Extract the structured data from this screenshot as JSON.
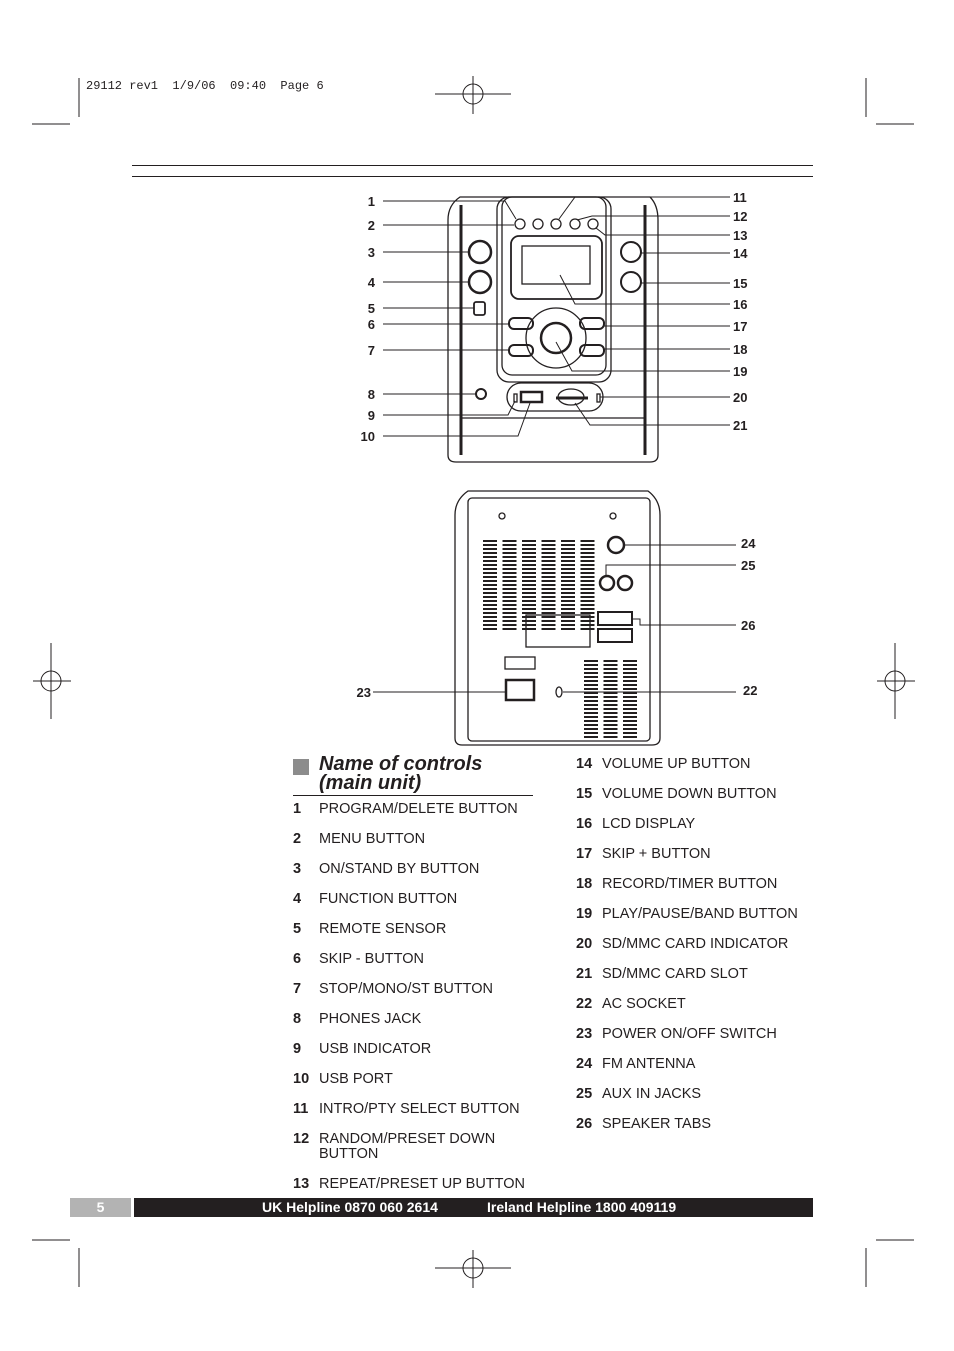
{
  "slug": "29112 rev1  1/9/06  09:40  Page 6",
  "heading": {
    "line1": "Name of controls",
    "line2": "(main unit)"
  },
  "front_callouts_left": [
    "1",
    "2",
    "3",
    "4",
    "5",
    "6",
    "7",
    "8",
    "9",
    "10"
  ],
  "front_callouts_right": [
    "11",
    "12",
    "13",
    "14",
    "15",
    "16",
    "17",
    "18",
    "19",
    "20",
    "21"
  ],
  "back_callouts": [
    "24",
    "25",
    "26",
    "22",
    "23"
  ],
  "controls_left": [
    {
      "n": "1",
      "label": "PROGRAM/DELETE BUTTON"
    },
    {
      "n": "2",
      "label": "MENU BUTTON"
    },
    {
      "n": "3",
      "label": "ON/STAND BY BUTTON"
    },
    {
      "n": "4",
      "label": "FUNCTION BUTTON"
    },
    {
      "n": "5",
      "label": "REMOTE SENSOR"
    },
    {
      "n": "6",
      "label": "SKIP - BUTTON"
    },
    {
      "n": "7",
      "label": "STOP/MONO/ST BUTTON"
    },
    {
      "n": "8",
      "label": "PHONES JACK"
    },
    {
      "n": "9",
      "label": "USB INDICATOR"
    },
    {
      "n": "10",
      "label": "USB PORT"
    },
    {
      "n": "11",
      "label": "INTRO/PTY SELECT BUTTON"
    },
    {
      "n": "12",
      "label": "RANDOM/PRESET DOWN BUTTON"
    },
    {
      "n": "13",
      "label": "REPEAT/PRESET UP BUTTON"
    }
  ],
  "controls_right": [
    {
      "n": "14",
      "label": "VOLUME UP BUTTON"
    },
    {
      "n": "15",
      "label": "VOLUME DOWN BUTTON"
    },
    {
      "n": "16",
      "label": "LCD DISPLAY"
    },
    {
      "n": "17",
      "label": "SKIP + BUTTON"
    },
    {
      "n": "18",
      "label": "RECORD/TIMER BUTTON"
    },
    {
      "n": "19",
      "label": "PLAY/PAUSE/BAND BUTTON"
    },
    {
      "n": "20",
      "label": "SD/MMC CARD INDICATOR"
    },
    {
      "n": "21",
      "label": "SD/MMC CARD SLOT"
    },
    {
      "n": "22",
      "label": "AC SOCKET"
    },
    {
      "n": "23",
      "label": "POWER ON/OFF SWITCH"
    },
    {
      "n": "24",
      "label": "FM ANTENNA"
    },
    {
      "n": "25",
      "label": "AUX IN JACKS"
    },
    {
      "n": "26",
      "label": "SPEAKER TABS"
    }
  ],
  "footer": {
    "page": "5",
    "uk_label": "UK Helpline",
    "uk_number": "0870 060 2614",
    "ie_label": "Ireland Helpline",
    "ie_number": "1800 409119"
  }
}
